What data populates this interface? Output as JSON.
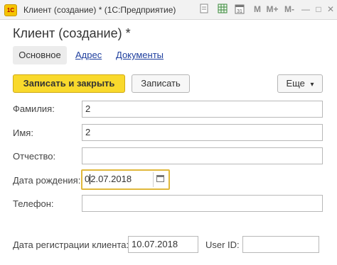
{
  "window": {
    "logo_text": "1С",
    "title": "Клиент (создание) * (1С:Предприятие)",
    "toolbar_icons": [
      "document-icon",
      "table-icon",
      "calendar-icon",
      "m-icon",
      "m-plus-icon",
      "m-minus-icon",
      "minimize-icon",
      "maximize-icon",
      "close-icon"
    ],
    "toolbar_labels": {
      "m": "M",
      "m_plus": "M+",
      "m_minus": "M-",
      "minimize": "—",
      "maximize": "□",
      "close": "✕"
    }
  },
  "form": {
    "title": "Клиент (создание) *",
    "tabs": [
      {
        "label": "Основное",
        "active": true
      },
      {
        "label": "Адрес",
        "active": false
      },
      {
        "label": "Документы",
        "active": false
      }
    ]
  },
  "command_bar": {
    "save_close_label": "Записать и закрыть",
    "save_label": "Записать",
    "more_label": "Еще",
    "more_caret": "▾"
  },
  "fields": {
    "last_name": {
      "label": "Фамилия:",
      "value": "2"
    },
    "first_name": {
      "label": "Имя:",
      "value": "2"
    },
    "patronymic": {
      "label": "Отчество:",
      "value": ""
    },
    "birth_date": {
      "label": "Дата рождения:",
      "value_before_cursor": "0",
      "value_after_cursor": "2.07.2018"
    },
    "phone": {
      "label": "Телефон:",
      "value": ""
    },
    "registration_date": {
      "label": "Дата регистрации клиента:",
      "value": "10.07.2018"
    },
    "user_id": {
      "label": "User ID:",
      "value": ""
    }
  },
  "colors": {
    "primary_button": "#f9d92c",
    "focus_border": "#e0b83c",
    "link": "#1f3f9e"
  }
}
